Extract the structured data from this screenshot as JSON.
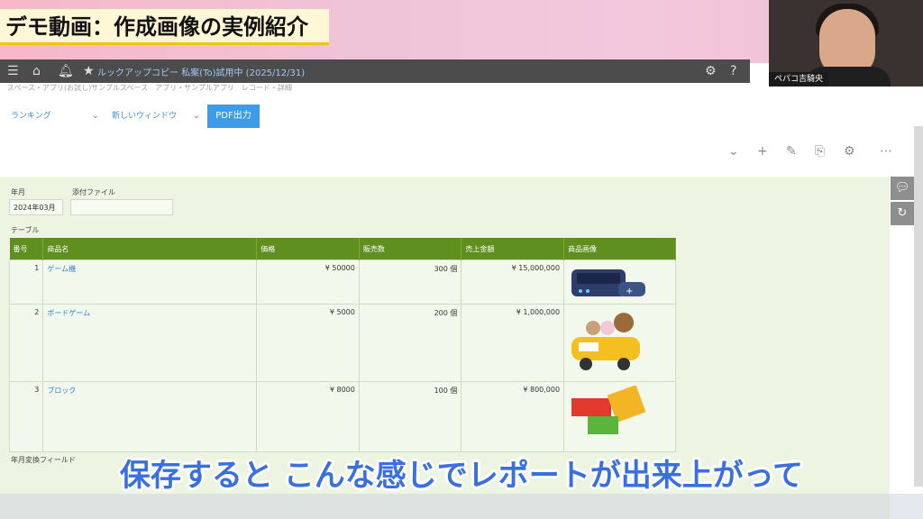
{
  "banner": {
    "title": "デモ動画：作成画像の実例紹介"
  },
  "webcam": {
    "name": "ペパコ吉騎央"
  },
  "appbar": {
    "breadcrumb": "ルックアップコピー 私案(To)試用中 (2025/12/31)",
    "icons": [
      "menu-icon",
      "home-icon",
      "bell-icon",
      "star-icon",
      "gear-icon",
      "help-icon"
    ]
  },
  "subcrumb": "スペース・アプリ(お試し)サンプルスペース　アプリ・サンプルアプリ　レコード・詳細",
  "toolbar": {
    "ranking_dropdown": "ランキング",
    "window_dropdown": "新しいウィンドウ",
    "pdf_button": "PDF出力"
  },
  "record": {
    "year_month_label": "年月",
    "year_month_value": "2024年03月",
    "attachment_label": "添付ファイル",
    "table_label": "テーブル",
    "bottom_field_label": "年月変換フィールド",
    "table": {
      "headers": [
        "番号",
        "商品名",
        "価格",
        "販売数",
        "売上金額",
        "商品画像"
      ],
      "rows": [
        {
          "no": "1",
          "name": "ゲーム機",
          "price": "¥ 50000",
          "qty": "300 個",
          "sales": "¥ 15,000,000",
          "image": "game-console-image"
        },
        {
          "no": "2",
          "name": "ボードゲーム",
          "price": "¥ 5000",
          "qty": "200 個",
          "sales": "¥ 1,000,000",
          "image": "toy-car-animals-image"
        },
        {
          "no": "3",
          "name": "ブロック",
          "price": "¥ 8000",
          "qty": "100 個",
          "sales": "¥ 800,000",
          "image": "lego-blocks-image"
        }
      ]
    }
  },
  "caption": "保存すると こんな感じでレポートが出来上がって"
}
